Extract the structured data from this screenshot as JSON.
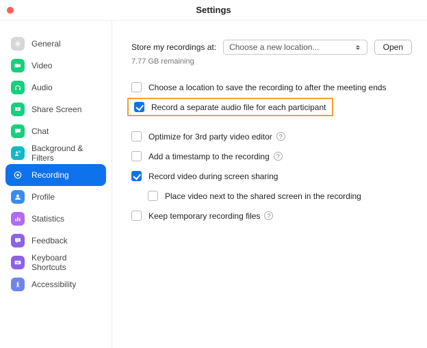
{
  "window": {
    "title": "Settings"
  },
  "sidebar": {
    "items": [
      {
        "key": "general",
        "label": "General",
        "color": "#d7d7d7",
        "icon": "gear"
      },
      {
        "key": "video",
        "label": "Video",
        "color": "#17d07d",
        "icon": "camera"
      },
      {
        "key": "audio",
        "label": "Audio",
        "color": "#17d07d",
        "icon": "headphones"
      },
      {
        "key": "share",
        "label": "Share Screen",
        "color": "#17d07d",
        "icon": "share"
      },
      {
        "key": "chat",
        "label": "Chat",
        "color": "#17d07d",
        "icon": "chat"
      },
      {
        "key": "bg",
        "label": "Background & Filters",
        "color": "#11b9c8",
        "icon": "background"
      },
      {
        "key": "rec",
        "label": "Recording",
        "color": "#ffffff",
        "icon": "record",
        "active": true
      },
      {
        "key": "profile",
        "label": "Profile",
        "color": "#3b8cf0",
        "icon": "profile"
      },
      {
        "key": "stats",
        "label": "Statistics",
        "color": "#b06cf0",
        "icon": "stats"
      },
      {
        "key": "feedback",
        "label": "Feedback",
        "color": "#8b63e6",
        "icon": "feedback"
      },
      {
        "key": "keys",
        "label": "Keyboard Shortcuts",
        "color": "#8b63e6",
        "icon": "keyboard"
      },
      {
        "key": "access",
        "label": "Accessibility",
        "color": "#6f86e6",
        "icon": "accessibility"
      }
    ]
  },
  "main": {
    "store_label": "Store my recordings at:",
    "location_value": "Choose a new location...",
    "open_button": "Open",
    "remaining": "7.77 GB remaining",
    "options": [
      {
        "label": "Choose a location to save the recording to after the meeting ends",
        "checked": false
      },
      {
        "label": "Record a separate audio file for each participant",
        "checked": true,
        "highlight": true
      },
      {
        "label": "Optimize for 3rd party video editor",
        "checked": false,
        "help": true
      },
      {
        "label": "Add a timestamp to the recording",
        "checked": false,
        "help": true
      },
      {
        "label": "Record video during screen sharing",
        "checked": true
      },
      {
        "label": "Place video next to the shared screen in the recording",
        "checked": false,
        "indent": true
      },
      {
        "label": "Keep temporary recording files",
        "checked": false,
        "help": true
      }
    ]
  }
}
